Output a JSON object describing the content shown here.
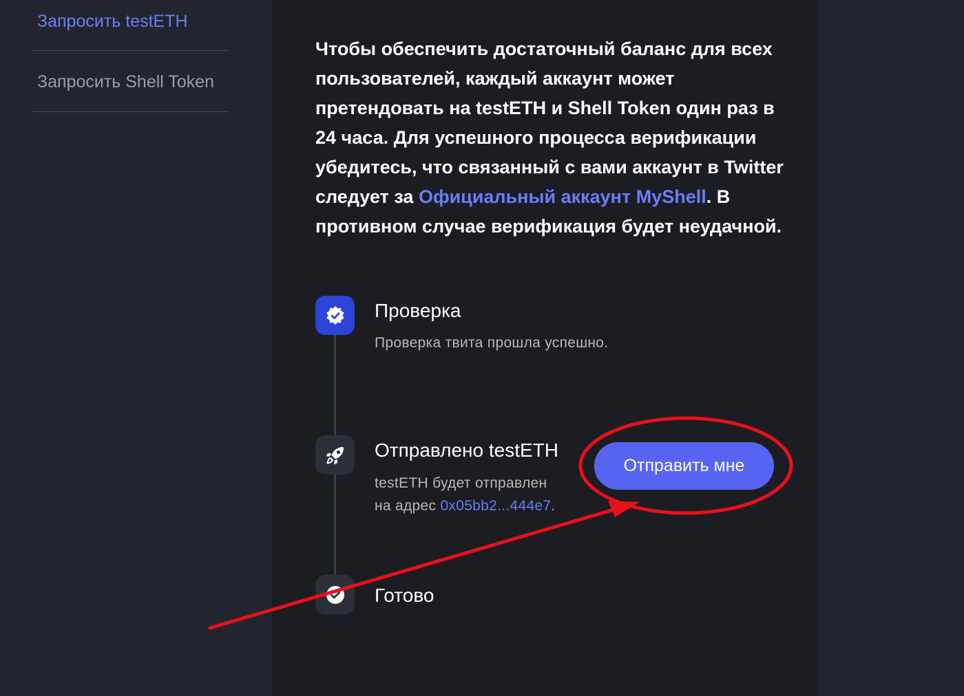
{
  "sidebar": {
    "items": [
      {
        "label": "Запросить testETH",
        "active": true
      },
      {
        "label": "Запросить Shell Token",
        "active": false
      }
    ]
  },
  "intro": {
    "text_before": "Чтобы обеспечить достаточный баланс для всех пользователей, каждый аккаунт может претендовать на testETH и Shell Token один раз в 24 часа. Для успешного процесса верификации убедитесь, что связанный с вами аккаунт в Twitter следует за ",
    "link_text": "Официальный аккаунт MyShell",
    "text_after": ". В противном случае верификация будет неудачной."
  },
  "steps": [
    {
      "title": "Проверка",
      "description": "Проверка твита прошла успешно.",
      "icon": "verified-badge-icon",
      "status": "done"
    },
    {
      "title": "Отправлено testETH",
      "description_line1": "testETH будет отправлен",
      "description_prefix": "на адрес ",
      "address": "0x05bb2...444e7",
      "description_suffix": ".",
      "icon": "rocket-icon",
      "status": "current"
    },
    {
      "title": "Готово",
      "icon": "check-circle-icon",
      "status": "pending"
    }
  ],
  "send_button": {
    "label": "Отправить мне"
  },
  "colors": {
    "accent": "#5865f2",
    "link": "#6b7df7",
    "background": "#1b1d23",
    "sidebar_background": "#22252d",
    "annotation": "#e8101a"
  }
}
